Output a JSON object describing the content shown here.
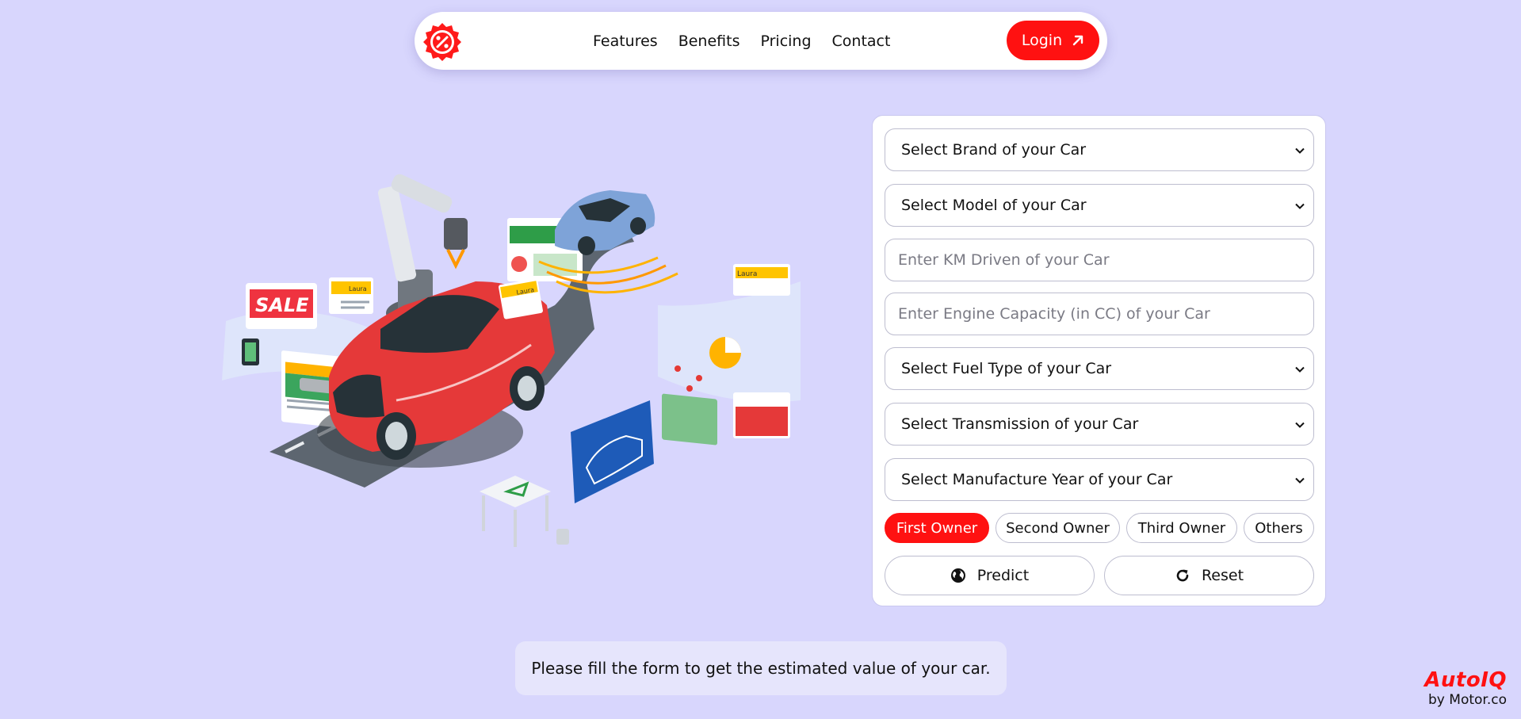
{
  "nav": {
    "links": [
      "Features",
      "Benefits",
      "Pricing",
      "Contact"
    ],
    "login_label": "Login",
    "logo_icon": "badge-percent-icon"
  },
  "illustration": {
    "sale_sign": "SALE",
    "tag_names": [
      "Laura",
      "Laura",
      "Laura"
    ]
  },
  "form": {
    "brand_select": "Select Brand of your Car",
    "model_select": "Select Model of your Car",
    "km_placeholder": "Enter KM Driven of your Car",
    "engine_placeholder": "Enter Engine Capacity (in CC) of your Car",
    "fuel_select": "Select Fuel Type of your Car",
    "transmission_select": "Select Transmission of your Car",
    "year_select": "Select Manufacture Year of your Car",
    "owners": [
      "First Owner",
      "Second Owner",
      "Third Owner",
      "Others"
    ],
    "selected_owner": "First Owner",
    "predict_label": "Predict",
    "reset_label": "Reset"
  },
  "status_message": "Please fill the form to get the estimated value of your car.",
  "brand": {
    "name": "AutoIQ",
    "tagline": "by Motor.co"
  },
  "colors": {
    "accent": "#ff1111",
    "background": "#d8d6fd"
  }
}
